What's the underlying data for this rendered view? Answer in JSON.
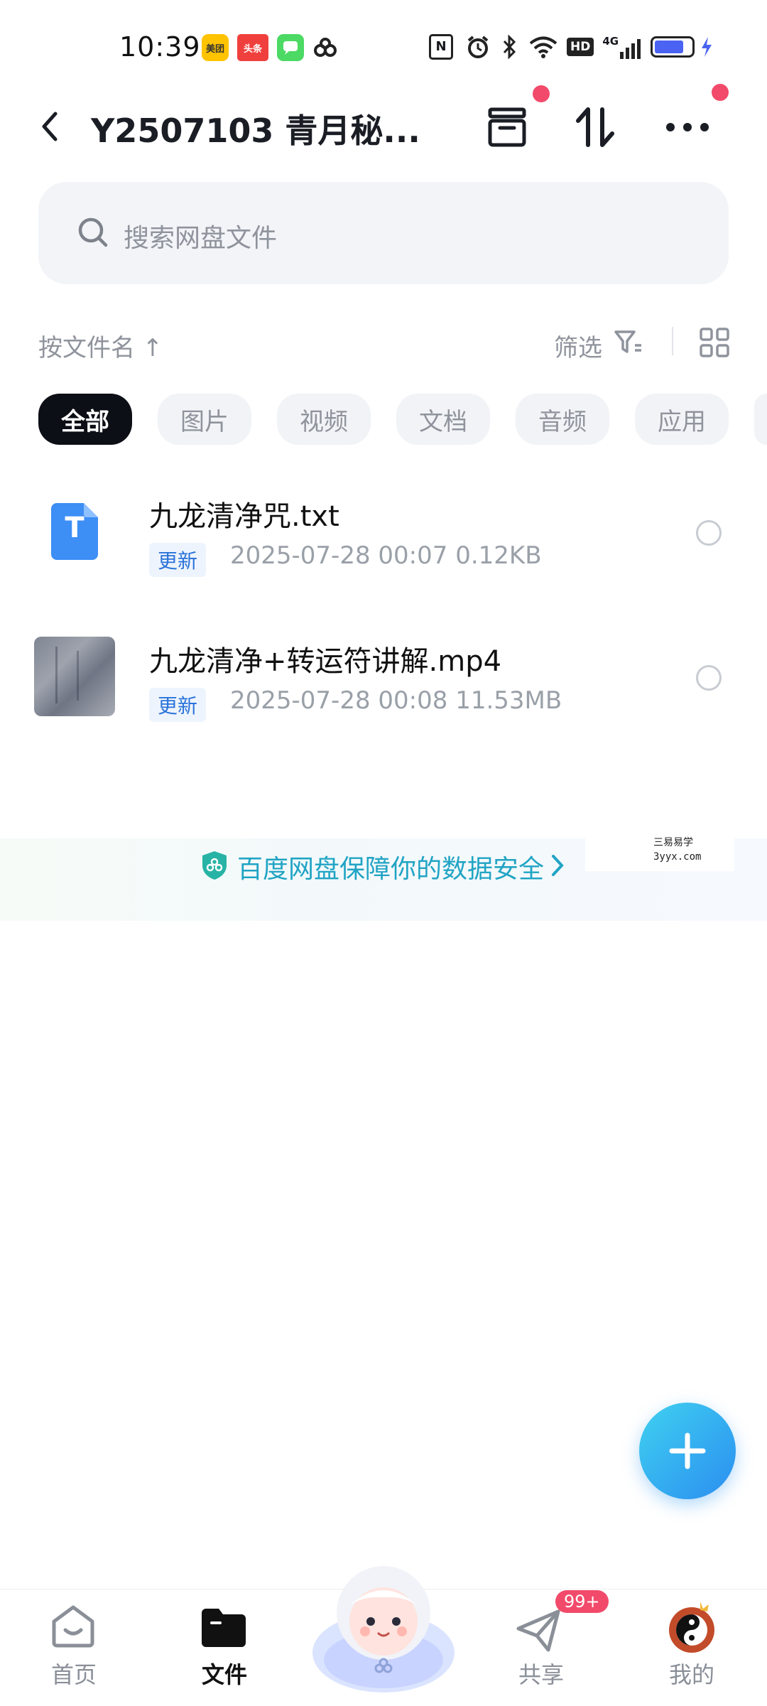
{
  "status_bar": {
    "time": "10:39",
    "apps": [
      {
        "icon": "meituan-icon",
        "label": "美团",
        "color": "#ffc300"
      },
      {
        "icon": "toutiao-icon",
        "label": "头条",
        "color": "#f0403d"
      },
      {
        "icon": "messages-icon",
        "label": "",
        "color": "#4cd964"
      },
      {
        "icon": "baidu-netdisk-icon",
        "label": "",
        "color": "#222222"
      }
    ],
    "indicators": [
      "nfc-icon",
      "alarm-icon",
      "bluetooth-icon",
      "wifi-icon",
      "hd-icon",
      "signal-4g-icon",
      "battery-icon",
      "charging-icon"
    ],
    "hd": "HD",
    "net": "4G"
  },
  "header": {
    "title": "Y2507103 青月秘..."
  },
  "search": {
    "placeholder": "搜索网盘文件"
  },
  "sort": {
    "label": "按文件名 ↑",
    "filter_label": "筛选"
  },
  "tabs": [
    {
      "label": "全部",
      "active": true
    },
    {
      "label": "图片",
      "active": false
    },
    {
      "label": "视频",
      "active": false
    },
    {
      "label": "文档",
      "active": false
    },
    {
      "label": "音频",
      "active": false
    },
    {
      "label": "应用",
      "active": false
    }
  ],
  "files": [
    {
      "name": "九龙清净咒.txt",
      "tag": "更新",
      "meta": "2025-07-28  00:07  0.12KB",
      "icon": "txt-file-icon",
      "icon_letter": "T"
    },
    {
      "name": "九龙清净+转运符讲解.mp4",
      "tag": "更新",
      "meta": "2025-07-28  00:08  11.53MB",
      "icon": "video-thumbnail"
    }
  ],
  "banner": {
    "text": "百度网盘保障你的数据安全",
    "watermark_line1": "三易易学",
    "watermark_line2": "3yyx.com"
  },
  "bottom_nav": [
    {
      "label": "首页",
      "icon": "home-icon",
      "active": false
    },
    {
      "label": "文件",
      "icon": "folder-icon",
      "active": true
    },
    {
      "label": "",
      "icon": "mascot-icon",
      "active": false
    },
    {
      "label": "共享",
      "icon": "share-icon",
      "active": false,
      "badge": "99+"
    },
    {
      "label": "我的",
      "icon": "avatar-icon",
      "active": false
    }
  ],
  "colors": {
    "accent": "#2b8ef0",
    "badge": "#f24a6b",
    "tag": "#2a73d9",
    "banner_text": "#21a4c4"
  }
}
